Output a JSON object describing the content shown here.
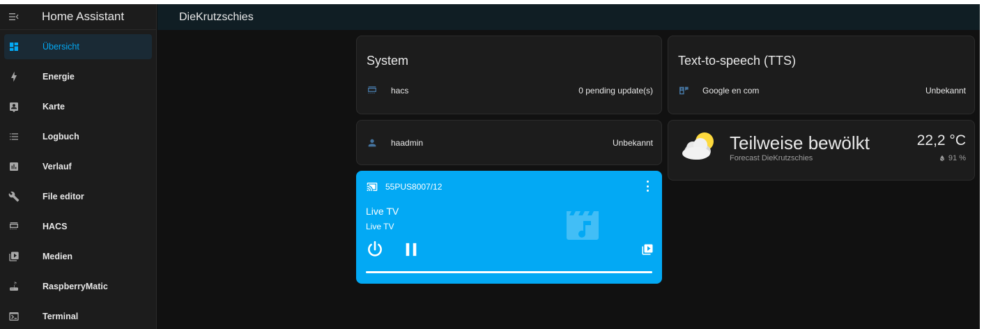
{
  "app": {
    "title": "Home Assistant"
  },
  "header": {
    "dashboard_title": "DieKrutzschies"
  },
  "sidebar": {
    "items": [
      {
        "label": "Übersicht",
        "icon": "dashboard-icon",
        "active": true
      },
      {
        "label": "Energie",
        "icon": "lightning-icon"
      },
      {
        "label": "Karte",
        "icon": "map-icon"
      },
      {
        "label": "Logbuch",
        "icon": "logbook-icon"
      },
      {
        "label": "Verlauf",
        "icon": "history-chart-icon"
      },
      {
        "label": "File editor",
        "icon": "wrench-icon"
      },
      {
        "label": "HACS",
        "icon": "hacs-icon"
      },
      {
        "label": "Medien",
        "icon": "media-play-box-icon"
      },
      {
        "label": "RaspberryMatic",
        "icon": "router-icon"
      },
      {
        "label": "Terminal",
        "icon": "console-icon"
      }
    ]
  },
  "cards": {
    "system": {
      "title": "System",
      "rows": [
        {
          "name": "hacs",
          "state": "0 pending update(s)",
          "icon": "hacs-icon"
        }
      ]
    },
    "user": {
      "rows": [
        {
          "name": "haadmin",
          "state": "Unbekannt",
          "icon": "account-icon"
        }
      ]
    },
    "tts": {
      "title": "Text-to-speech (TTS)",
      "rows": [
        {
          "name": "Google en com",
          "state": "Unbekannt",
          "icon": "speaker-message-icon"
        }
      ]
    },
    "media": {
      "device": "55PUS8007/12",
      "title": "Live TV",
      "subtitle": "Live TV",
      "progress": 1.0,
      "accent": "#03a9f4"
    },
    "weather": {
      "state": "Teilweise bewölkt",
      "name": "Forecast DieKrutzschies",
      "temperature": "22,2 °C",
      "humidity": "91 %",
      "icon": "partly-cloudy-icon"
    }
  },
  "colors": {
    "accent": "#03a9f4",
    "background": "#111111",
    "card": "#1c1c1c",
    "state_icon": "#44739e"
  }
}
